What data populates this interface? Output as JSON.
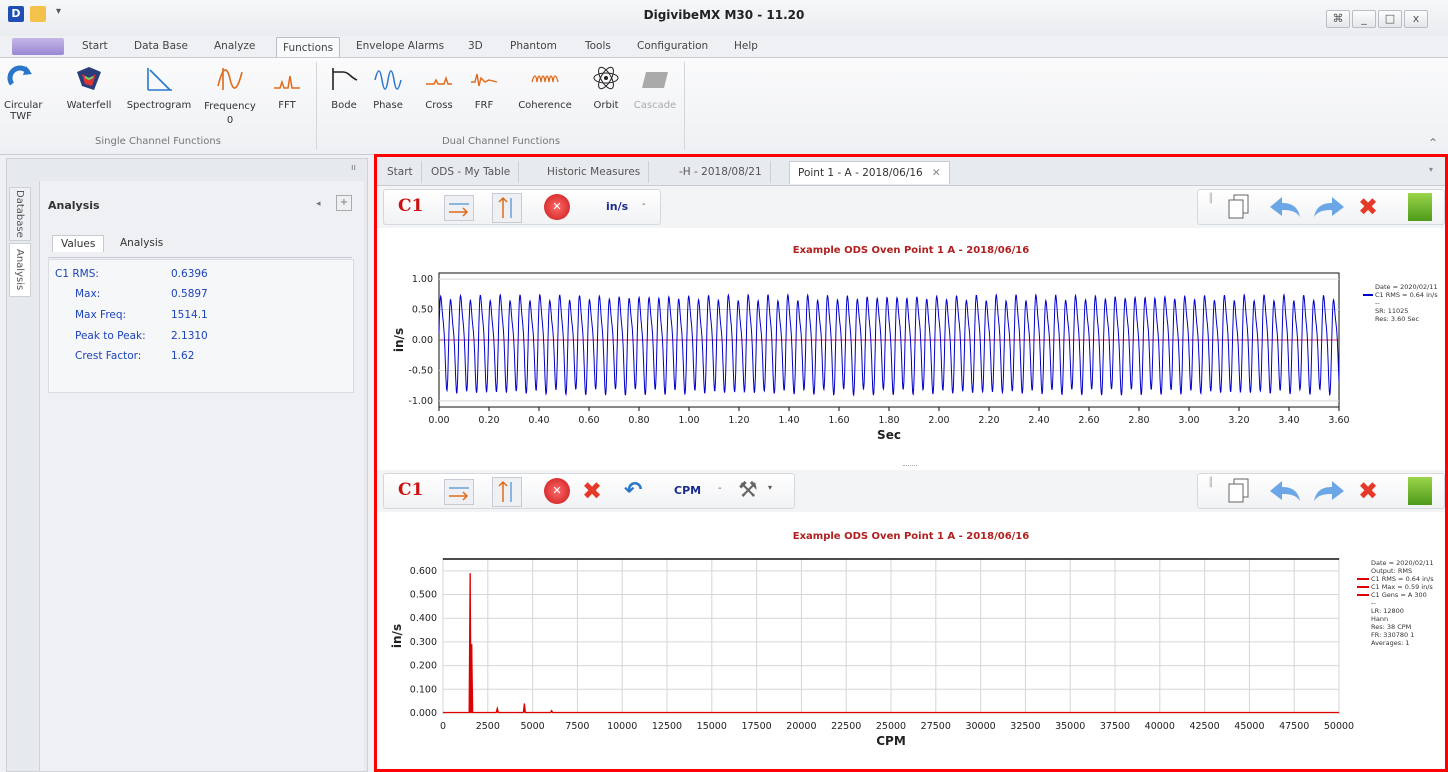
{
  "app": {
    "title": "DigivibeMX M30 - 11.20",
    "logo_letter": "D"
  },
  "window_buttons": {
    "restore_alt": "⌘",
    "minimize": "_",
    "maximize": "□",
    "close": "x"
  },
  "menu": {
    "items": [
      "Start",
      "Data Base",
      "Analyze",
      "Functions",
      "Envelope Alarms",
      "3D",
      "Phantom",
      "Tools",
      "Configuration",
      "Help"
    ],
    "active": "Functions"
  },
  "ribbon": {
    "single": [
      "Circular TWF",
      "Waterfell",
      "Spectrogram",
      "Frequency 0",
      "FFT"
    ],
    "dual": [
      "Bode",
      "Phase",
      "Cross",
      "FRF",
      "Coherence",
      "Orbit",
      "Cascade"
    ],
    "group_single": "Single Channel Functions",
    "group_dual": "Dual Channel Functions"
  },
  "sidebar": {
    "vertical_tabs": [
      "Database",
      "Analysis"
    ],
    "panel_title": "Analysis",
    "tabs": [
      "Values",
      "Analysis"
    ],
    "values": [
      {
        "label": "C1 RMS:",
        "value": "0.6396"
      },
      {
        "label": "Max:",
        "value": "0.5897"
      },
      {
        "label": "Max Freq:",
        "value": "1514.1"
      },
      {
        "label": "Peak to Peak:",
        "value": "2.1310"
      },
      {
        "label": "Crest Factor:",
        "value": "1.62"
      }
    ]
  },
  "doc_tabs": [
    "Start",
    "ODS - My Table",
    "Historic Measures",
    "-H - 2018/08/21",
    "Point 1 - A - 2018/06/16"
  ],
  "toolbar1": {
    "channel": "C1",
    "unit": "in/s"
  },
  "toolbar2": {
    "channel": "C1",
    "unit": "CPM"
  },
  "colors": {
    "wave": "#0000cc",
    "spectrum": "#dd0000",
    "frame": "#ff0000",
    "zero_line": "#cc3366"
  },
  "chart_data": [
    {
      "type": "line",
      "title": "Example ODS Oven Point 1 A - 2018/06/16",
      "xlabel": "Sec",
      "ylabel": "in/s",
      "xlim": [
        0,
        3.6
      ],
      "ylim": [
        -1.1,
        1.1
      ],
      "x_ticks": [
        "0.00",
        "0.20",
        "0.40",
        "0.60",
        "0.80",
        "1.00",
        "1.20",
        "1.40",
        "1.60",
        "1.80",
        "2.00",
        "2.20",
        "2.40",
        "2.60",
        "2.80",
        "3.00",
        "3.20",
        "3.40",
        "3.60"
      ],
      "y_ticks": [
        "1.00",
        "0.50",
        "0.00",
        "-0.50",
        "-1.00"
      ],
      "signal": {
        "frequency_hz": 25.2,
        "amplitude": 0.9
      },
      "legend": [
        "Date = 2020/02/11",
        "C1 RMS = 0.64 in/s",
        "--",
        "SR: 11025",
        "Res: 3.60 Sec"
      ]
    },
    {
      "type": "line",
      "title": "Example ODS Oven Point 1 A - 2018/06/16",
      "xlabel": "CPM",
      "ylabel": "in/s",
      "xlim": [
        0,
        50000
      ],
      "ylim": [
        0,
        0.65
      ],
      "x_ticks": [
        "0",
        "2500",
        "5000",
        "7500",
        "10000",
        "12500",
        "15000",
        "17500",
        "20000",
        "22500",
        "25000",
        "27500",
        "30000",
        "32500",
        "35000",
        "37500",
        "40000",
        "42500",
        "45000",
        "47500",
        "50000"
      ],
      "y_ticks": [
        "0.600",
        "0.500",
        "0.400",
        "0.300",
        "0.200",
        "0.100",
        "0.000"
      ],
      "peaks": [
        {
          "x": 1514,
          "y": 0.59
        },
        {
          "x": 1600,
          "y": 0.29
        },
        {
          "x": 3030,
          "y": 0.02
        },
        {
          "x": 4540,
          "y": 0.04
        },
        {
          "x": 6060,
          "y": 0.01
        }
      ],
      "legend": [
        "Date = 2020/02/11",
        "Output: RMS",
        "C1 RMS = 0.64 in/s",
        "C1 Max = 0.59 in/s",
        "C1 Gens = A 300",
        "--",
        "LR: 12800",
        "Hann",
        "Res: 38 CPM",
        "FR: 330780 1",
        "Averages: 1"
      ]
    }
  ]
}
